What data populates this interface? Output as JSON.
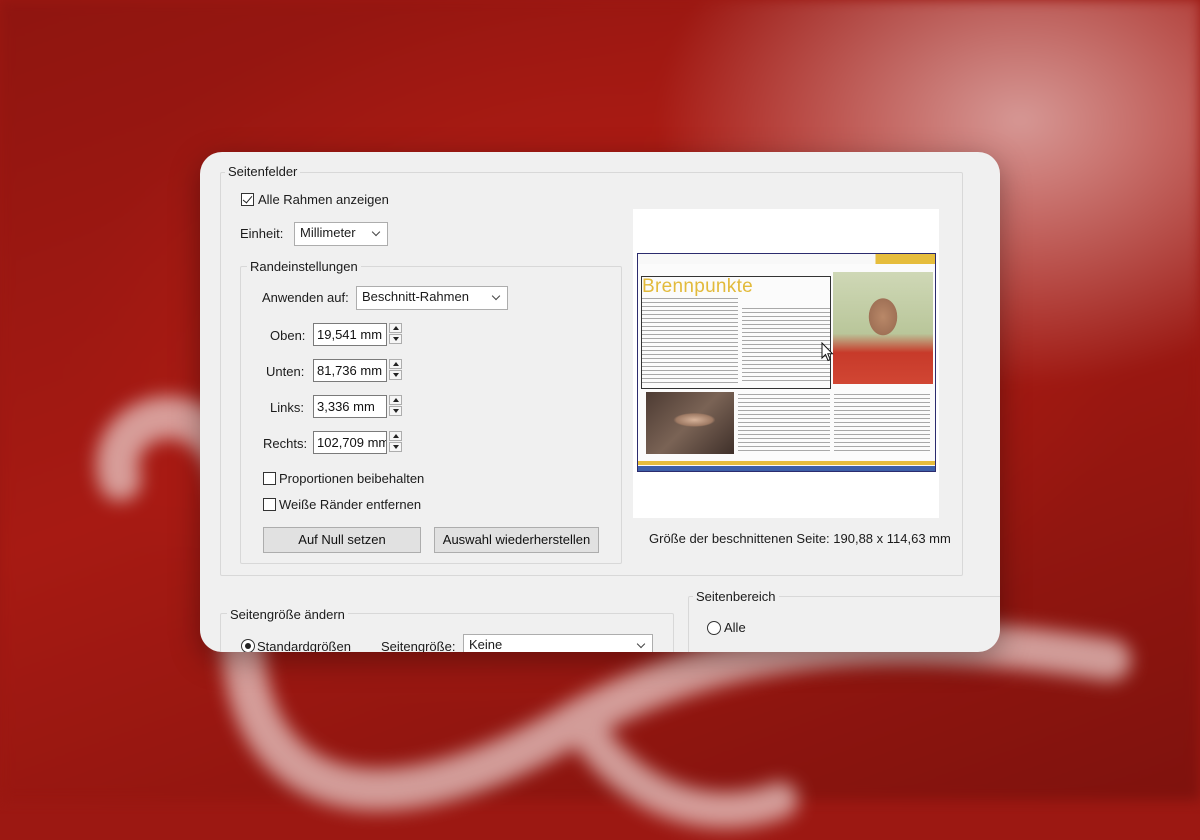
{
  "seitenfelder": {
    "legend": "Seitenfelder",
    "show_all_frames": {
      "label": "Alle Rahmen anzeigen",
      "checked": true
    },
    "unit": {
      "label": "Einheit:",
      "value": "Millimeter"
    },
    "randeinstellungen": {
      "legend": "Randeinstellungen",
      "apply_to": {
        "label": "Anwenden auf:",
        "value": "Beschnitt-Rahmen"
      },
      "fields": [
        {
          "label": "Oben:",
          "value": "19,541 mm"
        },
        {
          "label": "Unten:",
          "value": "81,736 mm"
        },
        {
          "label": "Links:",
          "value": "3,336 mm"
        },
        {
          "label": "Rechts:",
          "value": "102,709 mm"
        }
      ],
      "keep_proportions": {
        "label": "Proportionen beibehalten",
        "checked": false
      },
      "remove_white_margins": {
        "label": "Weiße Ränder entfernen",
        "checked": false
      },
      "reset_button": "Auf Null setzen",
      "restore_button": "Auswahl wiederherstellen"
    },
    "preview": {
      "page_heading": "Brennpunkte",
      "size_text": "Größe der beschnittenen Seite: 190,88 x 114,63 mm"
    }
  },
  "seitengroesse": {
    "legend": "Seitengröße ändern",
    "standard_sizes": {
      "label": "Standardgrößen",
      "checked": true
    },
    "page_size": {
      "label": "Seitengröße:",
      "value": "Keine"
    }
  },
  "seitenbereich": {
    "legend": "Seitenbereich",
    "all": {
      "label": "Alle",
      "checked": false
    }
  },
  "colors": {
    "backdrop_red": "#a71a13",
    "dialog_bg": "#f0f0f0",
    "preview_frame": "#2c2c6e",
    "accent_yellow": "#e6bd3c"
  }
}
